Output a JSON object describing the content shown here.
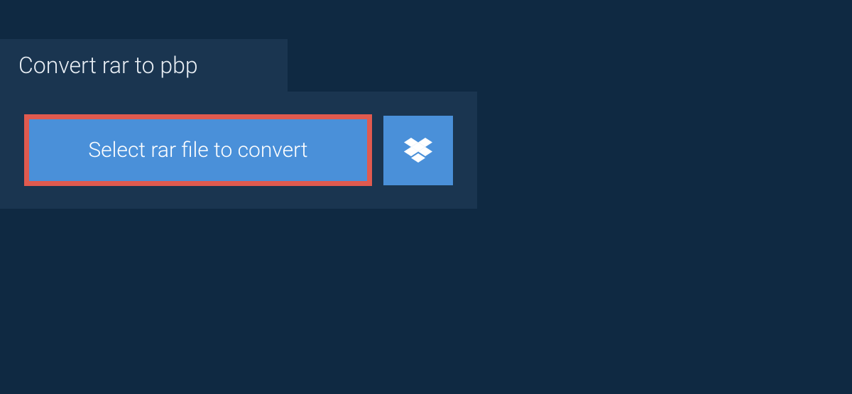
{
  "tab": {
    "title": "Convert rar to pbp"
  },
  "actions": {
    "select_file_label": "Select rar file to convert"
  },
  "colors": {
    "background": "#0f2942",
    "panel": "#1a3550",
    "button": "#4a90d9",
    "highlight_border": "#e05a4f",
    "text_light": "#ffffff"
  }
}
